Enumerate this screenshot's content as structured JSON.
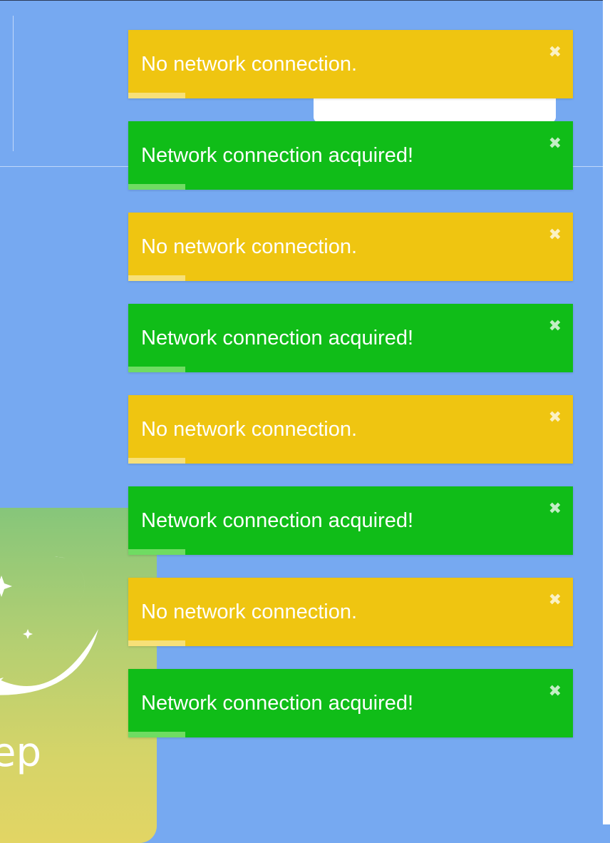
{
  "background": {
    "color": "#76a9f1"
  },
  "app_tile": {
    "label": "ep",
    "icon": "moon-stars-smile-icon"
  },
  "toasts": [
    {
      "type": "warning",
      "message": "No network connection.",
      "color": "#efc511",
      "close_icon": "close-x-icon"
    },
    {
      "type": "success",
      "message": "Network connection acquired!",
      "color": "#10bd18",
      "close_icon": "close-x-icon"
    },
    {
      "type": "warning",
      "message": "No network connection.",
      "color": "#efc511",
      "close_icon": "close-x-icon"
    },
    {
      "type": "success",
      "message": "Network connection acquired!",
      "color": "#10bd18",
      "close_icon": "close-x-icon"
    },
    {
      "type": "warning",
      "message": "No network connection.",
      "color": "#efc511",
      "close_icon": "close-x-icon"
    },
    {
      "type": "success",
      "message": "Network connection acquired!",
      "color": "#10bd18",
      "close_icon": "close-x-icon"
    },
    {
      "type": "warning",
      "message": "No network connection.",
      "color": "#efc511",
      "close_icon": "close-x-icon"
    },
    {
      "type": "success",
      "message": "Network connection acquired!",
      "color": "#10bd18",
      "close_icon": "close-x-icon"
    }
  ]
}
